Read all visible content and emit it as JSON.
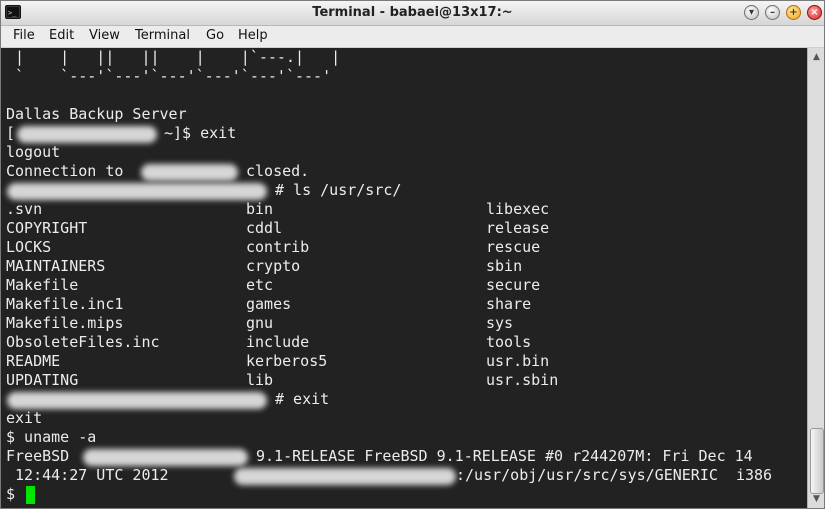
{
  "window": {
    "title": "Terminal - babaei@13x17:~"
  },
  "menu": {
    "file": "File",
    "edit": "Edit",
    "view": "View",
    "terminal": "Terminal",
    "go": "Go",
    "help": "Help"
  },
  "terminal": {
    "art1": " |    |   ||   ||    |    |`---.|   |",
    "art2": " `    `---'`---'`---'`---'`---'`---'",
    "server": "Dallas Backup Server",
    "p1_open": "[",
    "p1_cmd": "~]$ exit",
    "logout": "logout",
    "conn_prefix": "Connection to",
    "conn_suffix": "closed.",
    "p2_cmd": "# ls /usr/src/",
    "ls_col1": [
      ".svn",
      "COPYRIGHT",
      "LOCKS",
      "MAINTAINERS",
      "Makefile",
      "Makefile.inc1",
      "Makefile.mips",
      "ObsoleteFiles.inc",
      "README",
      "UPDATING"
    ],
    "ls_col2": [
      "bin",
      "cddl",
      "contrib",
      "crypto",
      "etc",
      "games",
      "gnu",
      "include",
      "kerberos5",
      "lib"
    ],
    "ls_col3": [
      "libexec",
      "release",
      "rescue",
      "sbin",
      "secure",
      "share",
      "sys",
      "tools",
      "usr.bin",
      "usr.sbin"
    ],
    "p3_cmd": "# exit",
    "exit": "exit",
    "uname": "$ uname -a",
    "un1_a": "FreeBSD",
    "un1_b": "9.1-RELEASE FreeBSD 9.1-RELEASE #0 r244207M: Fri Dec 14",
    "un2_a": " 12:44:27 UTC 2012",
    "un2_b": ":/usr/obj/usr/src/sys/GENERIC  i386",
    "prompt": "$"
  },
  "colors": {
    "background": "#222222",
    "foreground": "#ececec",
    "cursor": "#00e400"
  }
}
